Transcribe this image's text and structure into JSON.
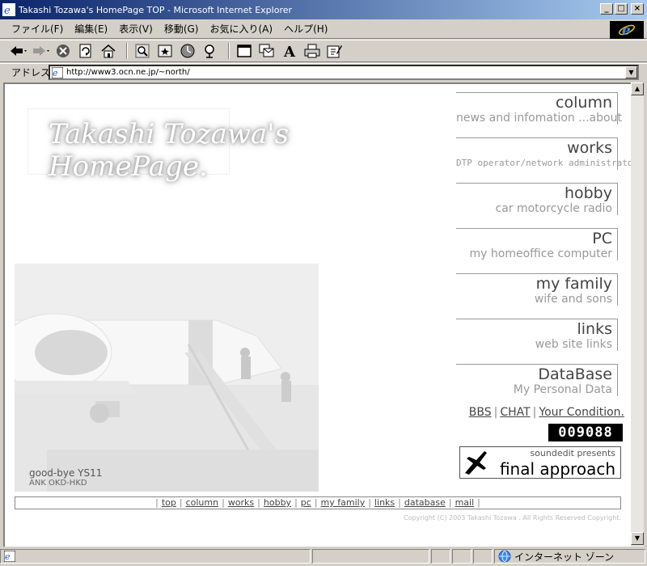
{
  "window": {
    "title": "Takashi Tozawa's HomePage TOP - Microsoft Internet Explorer",
    "minimize": "_",
    "maximize": "□",
    "close": "×"
  },
  "menu": [
    "ファイル(F)",
    "編集(E)",
    "表示(V)",
    "移動(G)",
    "お気に入り(A)",
    "ヘルプ(H)"
  ],
  "address": {
    "label": "アドレス",
    "url": "http://www3.ocn.ne.jp/~north/"
  },
  "page": {
    "logo_line1": "Takashi Tozawa's",
    "logo_line2": "HomePage.",
    "caption_main": "good-bye YS11",
    "caption_sub": "ANK OKD-HKD",
    "menu_blocks": [
      {
        "title": "column",
        "sub": "news and infomation ...about"
      },
      {
        "title": "works",
        "sub": "DTP operator/network administrator"
      },
      {
        "title": "hobby",
        "sub": "car motorcycle radio"
      },
      {
        "title": "PC",
        "sub": "my homeoffice computer"
      },
      {
        "title": "my family",
        "sub": "wife and sons"
      },
      {
        "title": "links",
        "sub": "web site links"
      },
      {
        "title": "DataBase",
        "sub": "My Personal Data"
      }
    ],
    "bbs": "BBS",
    "chat": "CHAT",
    "your_condition": "Your Condition.",
    "counter": "009088",
    "banner_small": "soundedit presents",
    "banner_big": "final approach",
    "nav": [
      "top",
      "column",
      "works",
      "hobby",
      "pc",
      "my family",
      "links",
      "database",
      "mail"
    ],
    "copyright": "Copyright (C) 2003 Takashi Tozawa . All Rights Reserved Copyright."
  },
  "status": {
    "zone": "インターネット ゾーン"
  },
  "colors": {
    "titlebar_start": "#0a246a",
    "titlebar_end": "#a6caf0",
    "chrome": "#d4d0c8"
  }
}
